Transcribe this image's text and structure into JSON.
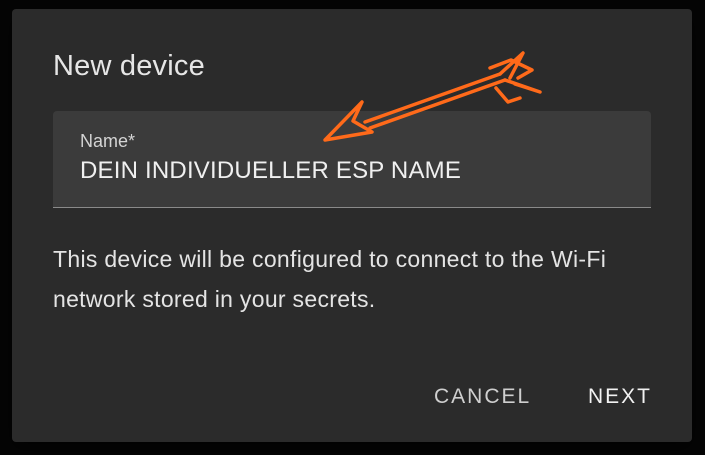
{
  "dialog": {
    "title": "New device",
    "name_field": {
      "label": "Name*",
      "value": "DEIN INDIVIDUELLER ESP NAME"
    },
    "description": "This device will be configured to connect to the Wi-Fi network stored in your secrets.",
    "actions": {
      "cancel_label": "CANCEL",
      "next_label": "NEXT"
    }
  },
  "annotation": {
    "icon": "arrow-icon",
    "color": "#ff6a1a"
  }
}
